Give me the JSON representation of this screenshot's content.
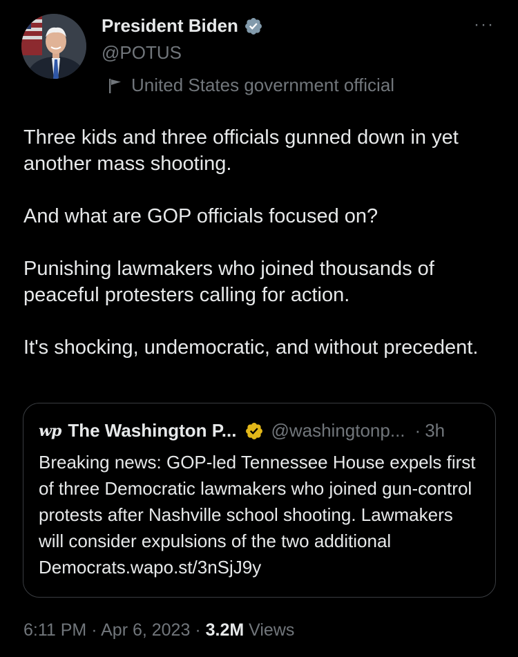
{
  "author": {
    "name": "President Biden",
    "handle": "@POTUS",
    "label": "United States government official",
    "badge_color": "#829aab"
  },
  "more_icon": "···",
  "tweet_text": [
    "Three kids and three officials gunned down in yet another mass shooting.",
    "And what are GOP officials focused on?",
    "Punishing lawmakers who joined thousands of peaceful protesters calling for action.",
    "It's shocking, undemocratic, and without precedent."
  ],
  "quote": {
    "logo_text": "wp",
    "name": "The Washington P...",
    "handle": "@washingtonp...",
    "separator": "·",
    "time": "3h",
    "badge_color": "#e2b719",
    "text": "Breaking news: GOP-led Tennessee House expels first of three Democratic lawmakers who joined gun-control protests after Nashville school shooting. Lawmakers will consider expulsions of the two additional Democrats.wapo.st/3nSjJ9y"
  },
  "meta": {
    "time": "6:11 PM",
    "sep1": "·",
    "date": "Apr 6, 2023",
    "sep2": "·",
    "views_count": "3.2M",
    "views_label": "Views"
  },
  "colors": {
    "background": "#000000",
    "text_primary": "#e7e9ea",
    "text_secondary": "#71767b",
    "border": "#3a3d41"
  }
}
